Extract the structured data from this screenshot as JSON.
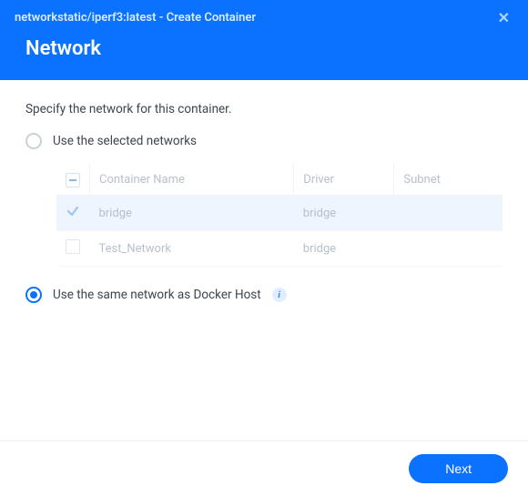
{
  "window": {
    "title": "networkstatic/iperf3:latest - Create Container",
    "section": "Network"
  },
  "content": {
    "subtitle": "Specify the network for this container.",
    "option_selected": "Use the selected networks",
    "option_host": "Use the same network as Docker Host"
  },
  "table": {
    "headers": {
      "name": "Container Name",
      "driver": "Driver",
      "subnet": "Subnet"
    },
    "rows": [
      {
        "checked": true,
        "name": "bridge",
        "driver": "bridge",
        "subnet": ""
      },
      {
        "checked": false,
        "name": "Test_Network",
        "driver": "bridge",
        "subnet": ""
      }
    ]
  },
  "footer": {
    "next": "Next"
  }
}
